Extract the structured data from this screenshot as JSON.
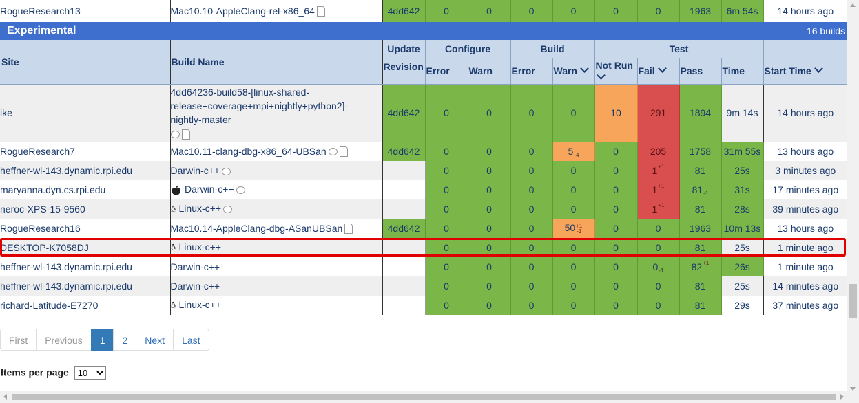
{
  "top_row": {
    "site": "RogueResearch13",
    "build_name": "Mac10.10-AppleClang-rel-x86_64",
    "revision": "4dd642",
    "cfg_error": "0",
    "cfg_warn": "0",
    "bld_error": "0",
    "bld_warn": "0",
    "not_run": "0",
    "fail": "0",
    "pass": "1963",
    "time": "6m 54s",
    "start": "14 hours ago"
  },
  "group": {
    "title": "Experimental",
    "count": "16 builds"
  },
  "headers": {
    "site": "Site",
    "build_name": "Build Name",
    "update": "Update",
    "configure": "Configure",
    "build": "Build",
    "test": "Test",
    "revision": "Revision",
    "error": "Error",
    "warn": "Warn",
    "not_run": "Not Run",
    "fail": "Fail",
    "pass": "Pass",
    "time": "Time",
    "start_time": "Start Time"
  },
  "rows": [
    {
      "site": "ike",
      "build_name": "4dd64236-build58-[linux-shared-release+coverage+mpi+nightly+python2]-nightly-master",
      "revision": "4dd642",
      "cfg_error": "0",
      "cfg_warn": "0",
      "bld_error": "0",
      "bld_warn": "0",
      "not_run": "10",
      "fail": "291",
      "pass": "1894",
      "time": "9m 14s",
      "start": "14 hours ago"
    },
    {
      "site": "RogueResearch7",
      "build_name": "Mac10.11-clang-dbg-x86_64-UBSan",
      "revision": "4dd642",
      "cfg_error": "0",
      "cfg_warn": "0",
      "bld_error": "0",
      "bld_warn": "5",
      "bld_warn_delta": "-4",
      "not_run": "0",
      "fail": "205",
      "pass": "1758",
      "time": "31m 55s",
      "start": "13 hours ago"
    },
    {
      "site": "heffner-wl-143.dynamic.rpi.edu",
      "build_name": "Darwin-c++",
      "revision": "",
      "cfg_error": "0",
      "cfg_warn": "0",
      "bld_error": "0",
      "bld_warn": "0",
      "not_run": "0",
      "fail": "1",
      "fail_delta": "+1",
      "pass": "81",
      "time": "25s",
      "start": "3 minutes ago"
    },
    {
      "site": "maryanna.dyn.cs.rpi.edu",
      "build_name": "Darwin-c++",
      "revision": "",
      "cfg_error": "0",
      "cfg_warn": "0",
      "bld_error": "0",
      "bld_warn": "0",
      "not_run": "0",
      "fail": "1",
      "fail_delta": "+1",
      "pass": "81",
      "pass_delta": "-1",
      "time": "31s",
      "start": "17 minutes ago"
    },
    {
      "site": "neroc-XPS-15-9560",
      "build_name": "Linux-c++",
      "revision": "",
      "cfg_error": "0",
      "cfg_warn": "0",
      "bld_error": "0",
      "bld_warn": "0",
      "not_run": "0",
      "fail": "1",
      "fail_delta": "+1",
      "pass": "81",
      "time": "28s",
      "start": "39 minutes ago"
    },
    {
      "site": "RogueResearch16",
      "build_name": "Mac10.14-AppleClang-dbg-ASanUBSan",
      "revision": "4dd642",
      "cfg_error": "0",
      "cfg_warn": "0",
      "bld_error": "0",
      "bld_warn": "50",
      "bld_warn_delta_up": "+1",
      "bld_warn_delta_dn": "-1",
      "not_run": "0",
      "fail": "0",
      "pass": "1963",
      "time": "10m 13s",
      "start": "13 hours ago"
    },
    {
      "site": "DESKTOP-K7058DJ",
      "build_name": "Linux-c++",
      "revision": "",
      "cfg_error": "0",
      "cfg_warn": "0",
      "bld_error": "0",
      "bld_warn": "0",
      "not_run": "0",
      "fail": "0",
      "pass": "81",
      "time": "25s",
      "start": "1 minute ago"
    },
    {
      "site": "heffner-wl-143.dynamic.rpi.edu",
      "build_name": "Darwin-c++",
      "revision": "",
      "cfg_error": "0",
      "cfg_warn": "0",
      "bld_error": "0",
      "bld_warn": "0",
      "not_run": "0",
      "fail": "0",
      "fail_delta": "-1",
      "pass": "82",
      "pass_delta": "+1",
      "time": "26s",
      "start": "1 minute ago"
    },
    {
      "site": "heffner-wl-143.dynamic.rpi.edu",
      "build_name": "Darwin-c++",
      "revision": "",
      "cfg_error": "0",
      "cfg_warn": "0",
      "bld_error": "0",
      "bld_warn": "0",
      "not_run": "0",
      "fail": "0",
      "pass": "81",
      "time": "25s",
      "start": "14 minutes ago"
    },
    {
      "site": "richard-Latitude-E7270",
      "build_name": "Linux-c++",
      "revision": "",
      "cfg_error": "0",
      "cfg_warn": "0",
      "bld_error": "0",
      "bld_warn": "0",
      "not_run": "0",
      "fail": "0",
      "pass": "81",
      "time": "29s",
      "start": "37 minutes ago"
    }
  ],
  "pagination": {
    "first": "First",
    "previous": "Previous",
    "page1": "1",
    "page2": "2",
    "next": "Next",
    "last": "Last"
  },
  "items_per_page": {
    "label": "Items per page",
    "value": "10"
  },
  "colors": {
    "pass_green": "#7ab648",
    "warn_orange": "#f8a55c",
    "fail_red": "#d94e4e",
    "group_blue": "#3e6fcf",
    "header_bg": "#c9d8ea",
    "highlight": "#e00000"
  }
}
